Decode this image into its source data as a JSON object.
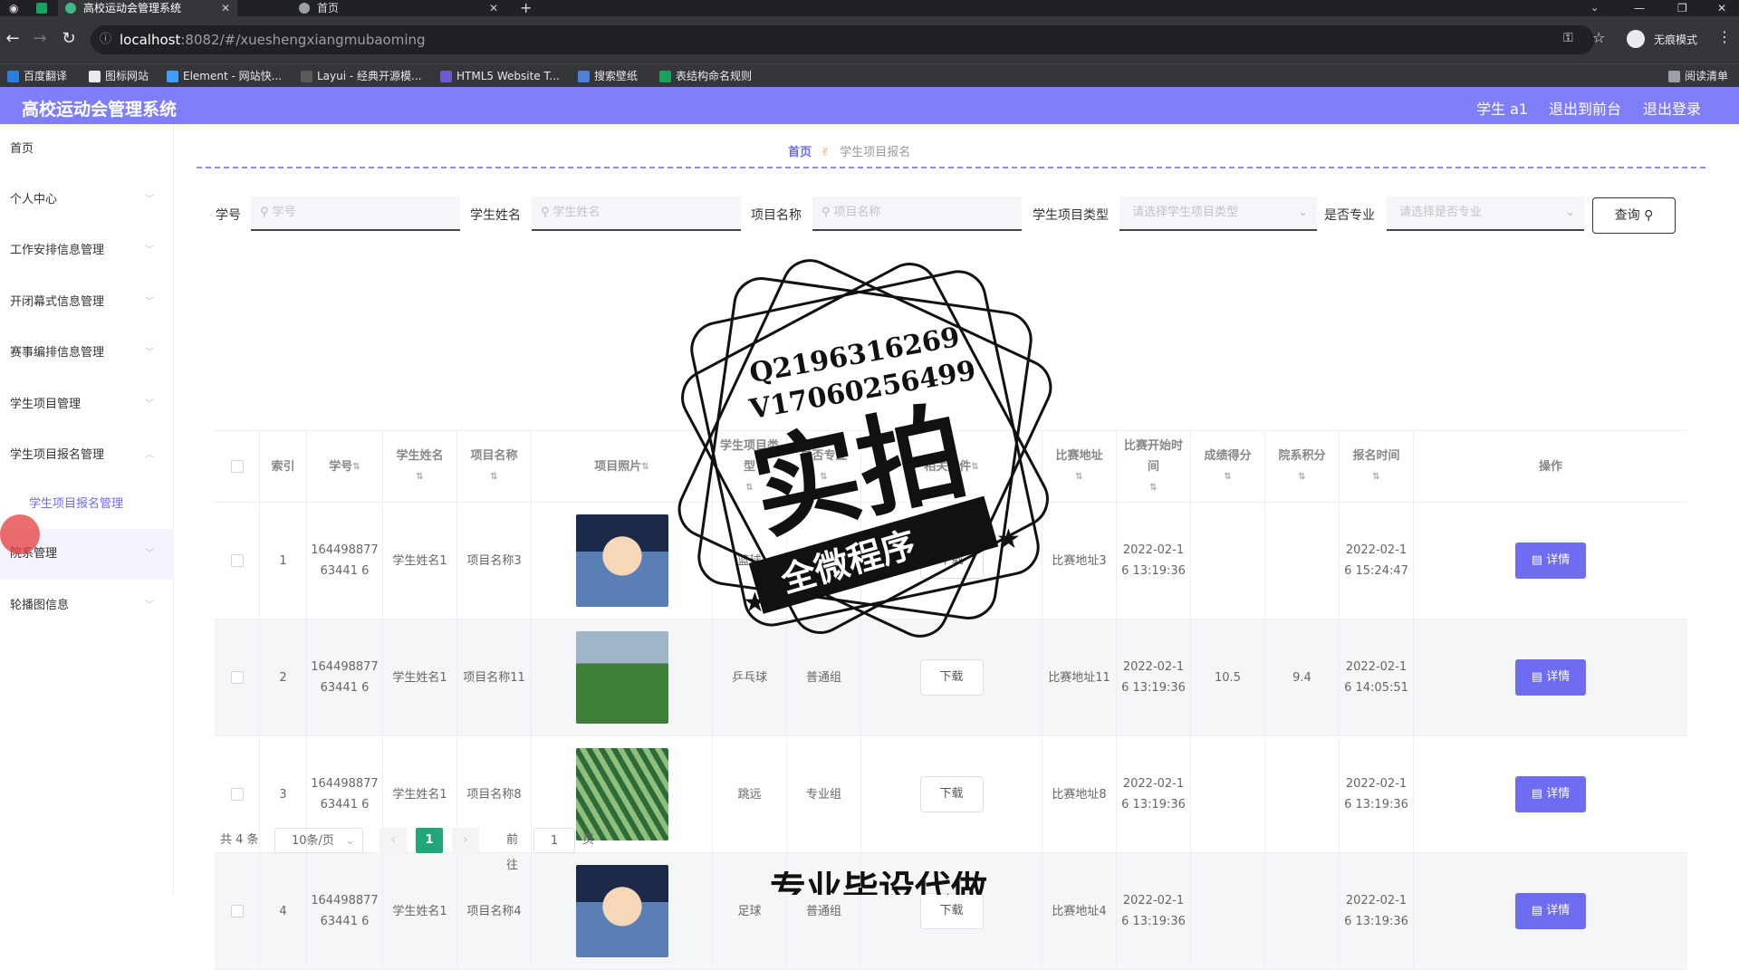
{
  "browser": {
    "tabs": [
      {
        "label": "高校运动会管理系统",
        "active": true
      },
      {
        "label": "首页",
        "active": false
      }
    ],
    "url_host": "localhost",
    "url_path": ":8082/#/xueshengxiangmubaoming",
    "incognito_label": "无痕模式",
    "bookmarks": [
      "百度翻译",
      "图标网站",
      "Element - 网站快...",
      "Layui - 经典开源模...",
      "HTML5 Website T...",
      "搜索壁纸",
      "表结构命名规则"
    ],
    "reading_list": "阅读清单"
  },
  "header": {
    "title": "高校运动会管理系统",
    "user": "学生 a1",
    "to_front": "退出到前台",
    "logout": "退出登录",
    "accent": "#7f7ef8"
  },
  "sidebar": {
    "items": [
      {
        "label": "首页"
      },
      {
        "label": "个人中心"
      },
      {
        "label": "工作安排信息管理"
      },
      {
        "label": "开闭幕式信息管理"
      },
      {
        "label": "赛事编排信息管理"
      },
      {
        "label": "学生项目管理"
      },
      {
        "label": "学生项目报名管理"
      },
      {
        "label": "院系管理"
      },
      {
        "label": "轮播图信息"
      }
    ],
    "sub_item": "学生项目报名管理"
  },
  "breadcrumb": {
    "home": "首页",
    "current": "学生项目报名"
  },
  "filters": {
    "student_no_label": "学号",
    "student_no_placeholder": "学号",
    "student_name_label": "学生姓名",
    "student_name_placeholder": "学生姓名",
    "project_name_label": "项目名称",
    "project_name_placeholder": "项目名称",
    "project_type_label": "学生项目类型",
    "project_type_placeholder": "请选择学生项目类型",
    "professional_label": "是否专业",
    "professional_placeholder": "请选择是否专业",
    "search_button": "查询"
  },
  "table": {
    "headers": [
      "索引",
      "学号",
      "学生姓名",
      "项目名称",
      "项目照片",
      "学生项目类型",
      "是否专业",
      "相关文件",
      "比赛地址",
      "比赛开始时间",
      "成绩得分",
      "院系积分",
      "报名时间",
      "操作"
    ],
    "download_label": "下载",
    "detail_label": "详情",
    "rows": [
      {
        "index": "1",
        "student_no": "16449887763441 6",
        "student_name": "学生姓名1",
        "project_name": "项目名称3",
        "photo": "cartoon",
        "type": "篮球",
        "professional": "",
        "address": "比赛地址3",
        "start_time": "2022-02-16 13:19:36",
        "score": "",
        "dept_points": "",
        "signup_time": "2022-02-16 15:24:47"
      },
      {
        "index": "2",
        "student_no": "16449887763441 6",
        "student_name": "学生姓名1",
        "project_name": "项目名称11",
        "photo": "field",
        "type": "乒乓球",
        "professional": "普通组",
        "address": "比赛地址11",
        "start_time": "2022-02-16 13:19:36",
        "score": "10.5",
        "dept_points": "9.4",
        "signup_time": "2022-02-16 14:05:51"
      },
      {
        "index": "3",
        "student_no": "16449887763441 6",
        "student_name": "学生姓名1",
        "project_name": "项目名称8",
        "photo": "fence",
        "type": "跳远",
        "professional": "专业组",
        "address": "比赛地址8",
        "start_time": "2022-02-16 13:19:36",
        "score": "",
        "dept_points": "",
        "signup_time": "2022-02-16 13:19:36"
      },
      {
        "index": "4",
        "student_no": "16449887763441 6",
        "student_name": "学生姓名1",
        "project_name": "项目名称4",
        "photo": "cartoon",
        "type": "足球",
        "professional": "普通组",
        "address": "比赛地址4",
        "start_time": "2022-02-16 13:19:36",
        "score": "",
        "dept_points": "",
        "signup_time": "2022-02-16 13:19:36"
      }
    ]
  },
  "pagination": {
    "total": "共 4 条",
    "page_size": "10条/页",
    "current_page": "1",
    "goto_prefix": "前往",
    "goto_value": "1",
    "goto_suffix": "页"
  },
  "watermark": {
    "line1": "Q2196316269",
    "line2": "V17060256499",
    "big": "实拍",
    "ribbon": "全微程序",
    "bottom": "专业毕设代做"
  }
}
